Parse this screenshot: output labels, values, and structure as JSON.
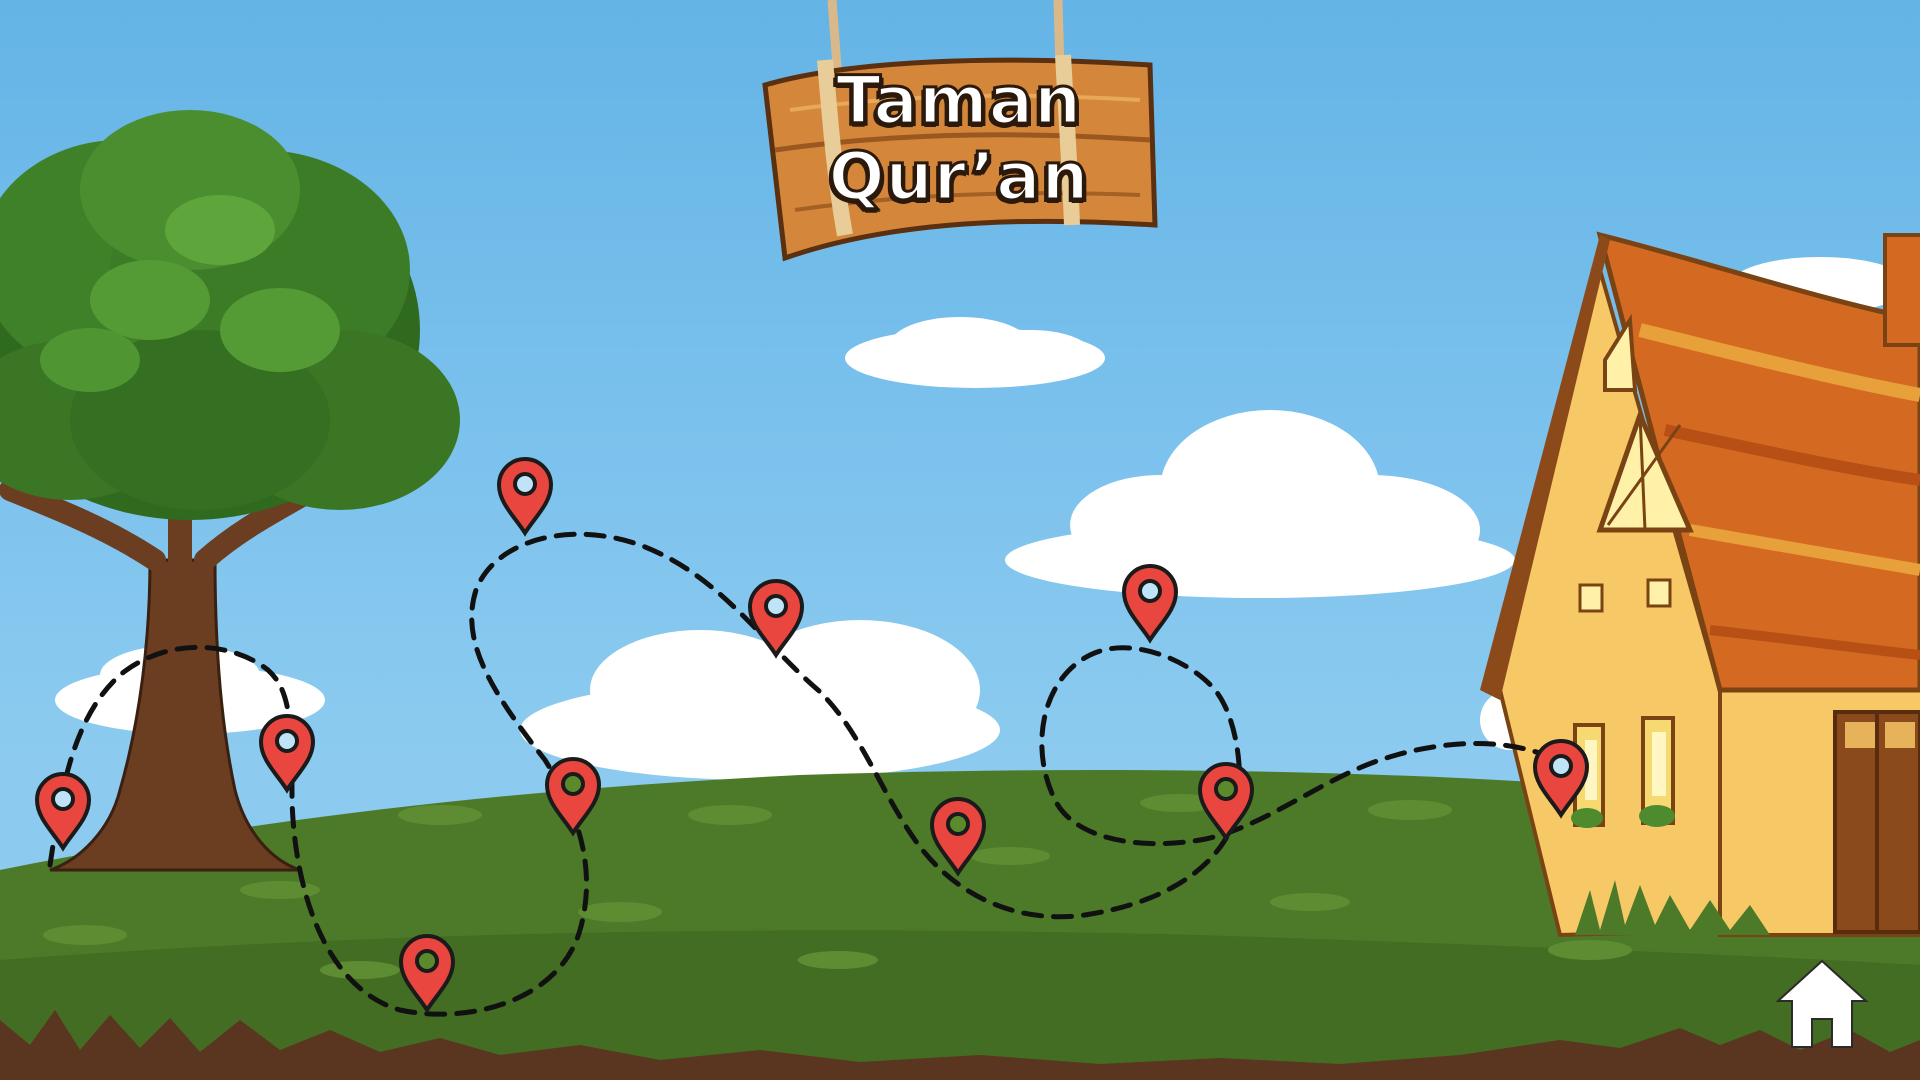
{
  "sign": {
    "line1": "Taman",
    "line2": "Qur’an"
  },
  "icons": {
    "home": "home-icon",
    "pin": "map-pin-icon",
    "tree": "tree",
    "house": "house"
  },
  "levels": [
    {
      "id": 1,
      "state": "unlocked"
    },
    {
      "id": 2,
      "state": "unlocked"
    },
    {
      "id": 3,
      "state": "locked"
    },
    {
      "id": 4,
      "state": "locked"
    },
    {
      "id": 5,
      "state": "unlocked"
    },
    {
      "id": 6,
      "state": "unlocked"
    },
    {
      "id": 7,
      "state": "locked"
    },
    {
      "id": 8,
      "state": "unlocked"
    },
    {
      "id": 9,
      "state": "locked"
    },
    {
      "id": 10,
      "state": "unlocked"
    },
    {
      "id": 11,
      "state": "unlocked"
    }
  ],
  "colors": {
    "sky": "#7ec3ee",
    "grass": "#4d7a28",
    "pin": "#e8463e",
    "pin_outline": "#1b1b1b",
    "wood": "#d4873a",
    "soil": "#5a3520"
  }
}
